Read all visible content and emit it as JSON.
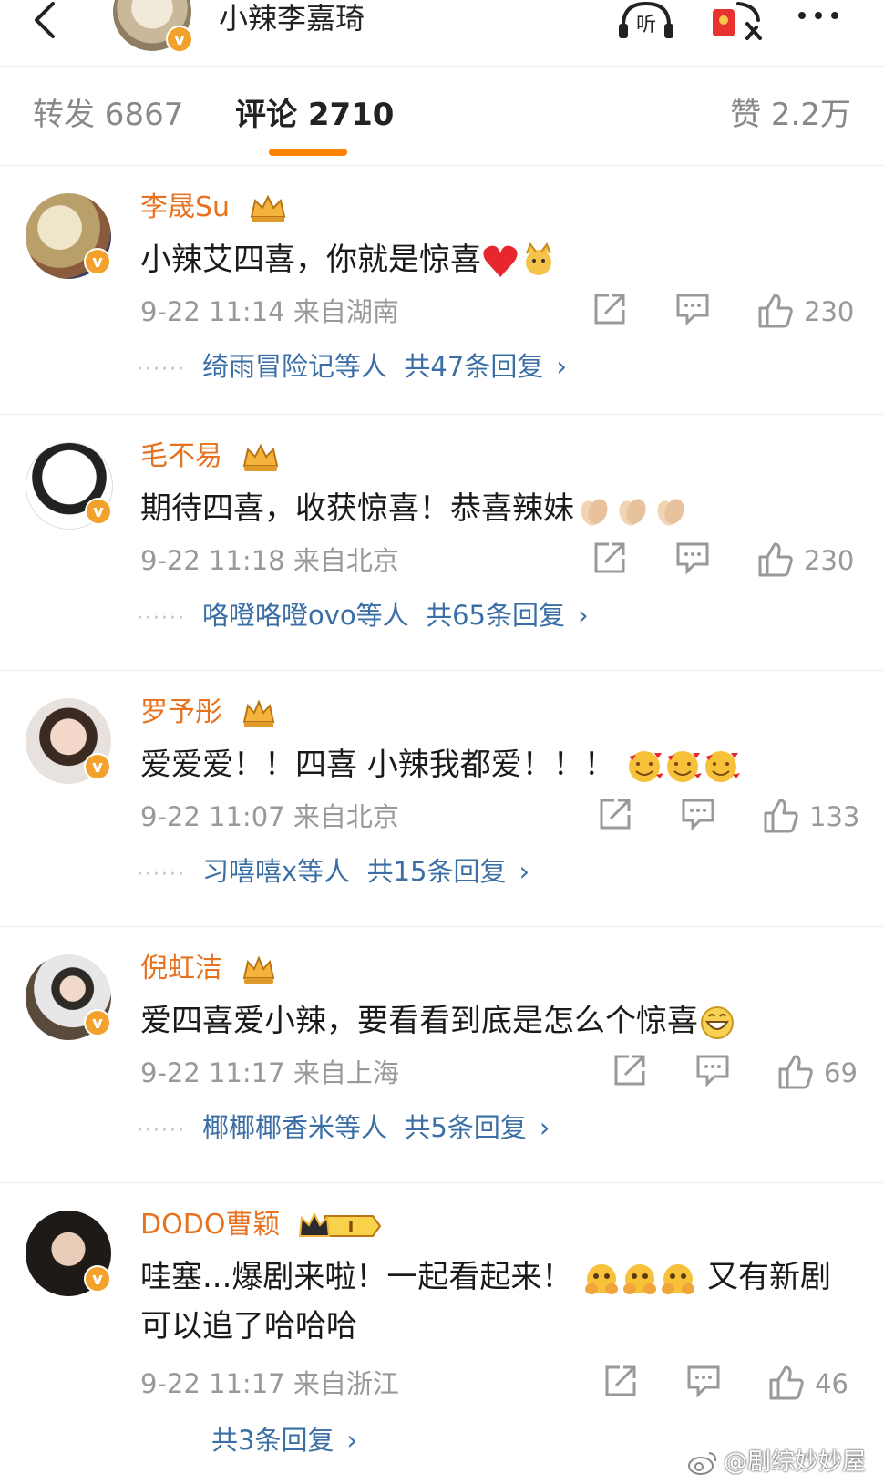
{
  "header": {
    "title": "小辣李嘉琦",
    "listen_label": "听"
  },
  "tabs": {
    "forward": "转发 6867",
    "comment": "评论 2710",
    "like": "赞 2.2万"
  },
  "colors": {
    "accent": "#ff8200",
    "username": "#e77320",
    "link": "#3a6ea5",
    "verified_badge": "#f2a12b"
  },
  "comments": [
    {
      "name": "李晟Su",
      "text": "小辣艾四喜，你就是惊喜",
      "meta": "9-22 11:14  来自湖南",
      "likes": "230",
      "reply_users": "绮雨冒险记等人",
      "reply_count": "共47条回复",
      "emojis": [
        "red-heart-icon",
        "cat-emoji-icon"
      ]
    },
    {
      "name": "毛不易",
      "text": "期待四喜，收获惊喜！恭喜辣妹",
      "meta": "9-22 11:18  来自北京",
      "likes": "230",
      "reply_users": "咯噔咯噔ovo等人",
      "reply_count": "共65条回复",
      "emojis": [
        "clapping-hands-icon",
        "clapping-hands-icon",
        "clapping-hands-icon"
      ]
    },
    {
      "name": "罗予彤",
      "text": "爱爱爱！！四喜 小辣我都爱！！！",
      "meta": "9-22 11:07  来自北京",
      "likes": "133",
      "reply_users": "习嘻嘻x等人",
      "reply_count": "共15条回复",
      "emojis": [
        "smiling-face-hearts-icon",
        "smiling-face-hearts-icon",
        "smiling-face-hearts-icon"
      ]
    },
    {
      "name": "倪虹洁",
      "text": "爱四喜爱小辣，要看看到底是怎么个惊喜",
      "meta": "9-22 11:17  来自上海",
      "likes": "69",
      "reply_users": "椰椰椰香米等人",
      "reply_count": "共5条回复",
      "emojis": [
        "grinning-face-icon"
      ]
    },
    {
      "name": "DODO曹颖",
      "text_part1": "哇塞...爆剧来啦！一起看起来！",
      "text_part2": "又有新剧可以追了哈哈哈",
      "meta": "9-22 11:17  来自浙江",
      "likes": "46",
      "reply_count": "共3条回复",
      "emojis": [
        "face-holding-back-tears-icon",
        "face-holding-back-tears-icon",
        "face-holding-back-tears-icon"
      ]
    }
  ],
  "watermark": "@剧综妙妙屋"
}
